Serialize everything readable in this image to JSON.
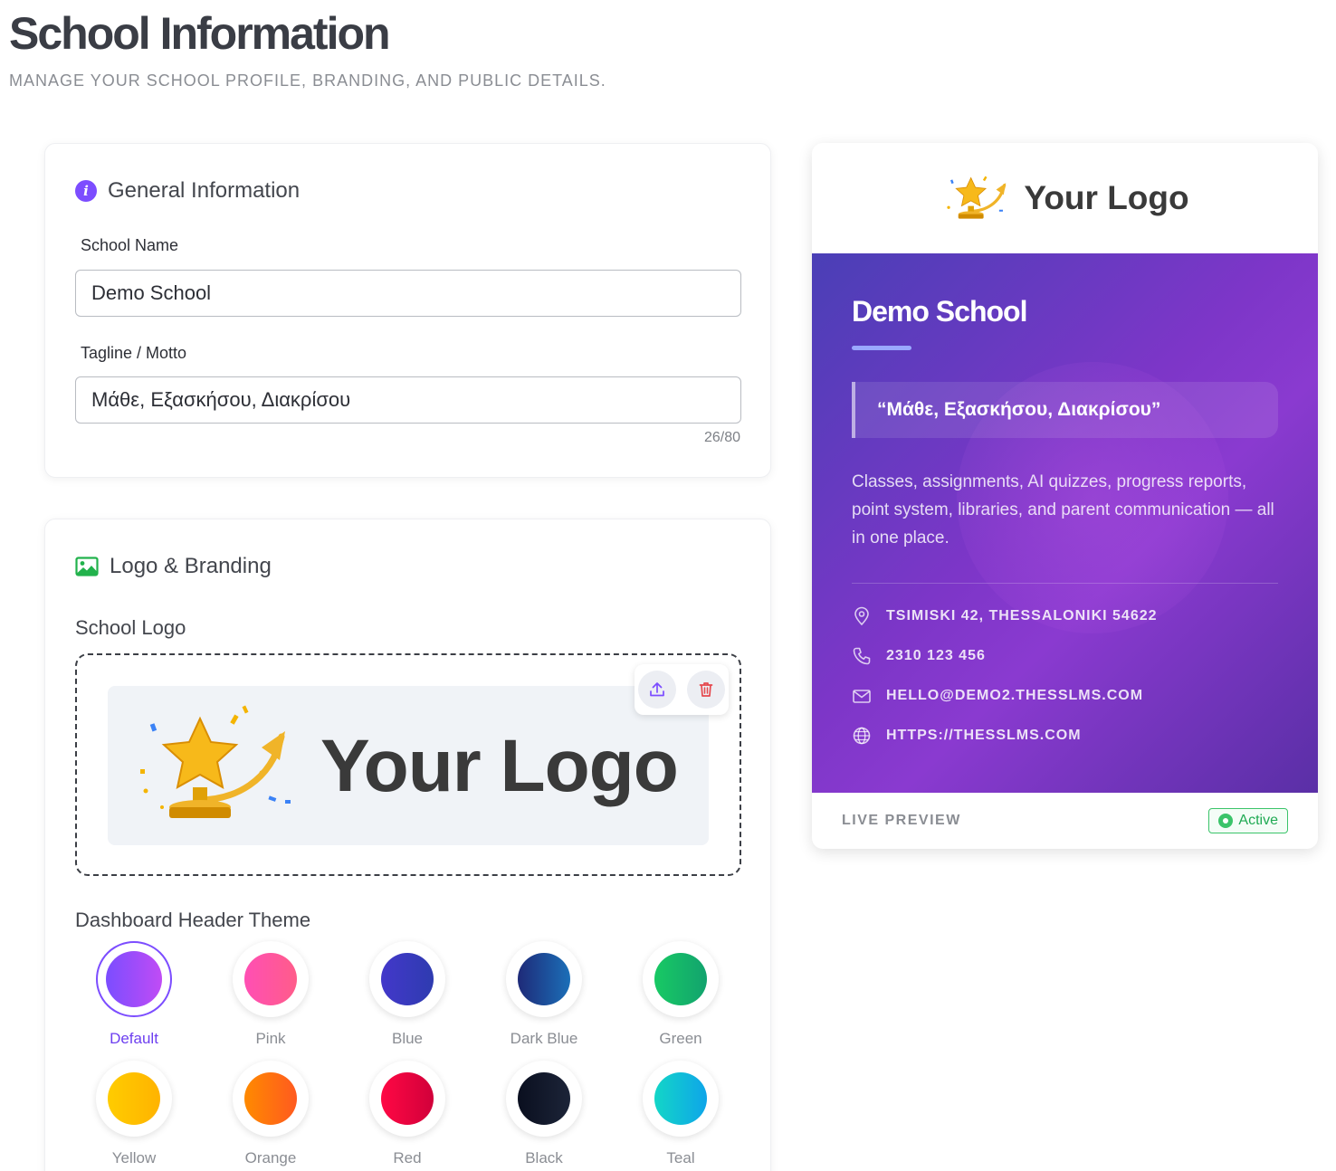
{
  "page": {
    "title": "School Information",
    "subtitle": "MANAGE YOUR SCHOOL PROFILE, BRANDING, AND PUBLIC DETAILS."
  },
  "general": {
    "heading": "General Information",
    "school_name_label": "School Name",
    "school_name_value": "Demo School",
    "tagline_label": "Tagline / Motto",
    "tagline_value": "Μάθε, Εξασκήσου, Διακρίσου",
    "tagline_counter": "26/80"
  },
  "branding": {
    "heading": "Logo & Branding",
    "logo_label": "School Logo",
    "logo_text": "Your Logo",
    "theme_label": "Dashboard Header Theme",
    "selected_theme": "Default",
    "themes": [
      {
        "name": "Default",
        "from": "#7b4dff",
        "to": "#c04cf5"
      },
      {
        "name": "Pink",
        "from": "#ff4fb4",
        "to": "#ff5c8a"
      },
      {
        "name": "Blue",
        "from": "#4338ca",
        "to": "#2e3bb0"
      },
      {
        "name": "Dark Blue",
        "from": "#1e2a78",
        "to": "#1b6fb8"
      },
      {
        "name": "Green",
        "from": "#18c964",
        "to": "#12a36e"
      },
      {
        "name": "Yellow",
        "from": "#ffcc00",
        "to": "#ffb300"
      },
      {
        "name": "Orange",
        "from": "#ff8a00",
        "to": "#ff5a1f"
      },
      {
        "name": "Red",
        "from": "#ff0844",
        "to": "#d1003a"
      },
      {
        "name": "Black",
        "from": "#0a0f1f",
        "to": "#1c2438"
      },
      {
        "name": "Teal",
        "from": "#13d6c7",
        "to": "#0ea5e9"
      }
    ]
  },
  "preview": {
    "logo_text": "Your Logo",
    "school_name": "Demo School",
    "quote": "“Μάθε, Εξασκήσου, Διακρίσου”",
    "description": "Classes, assignments, AI quizzes, progress reports, point system, libraries, and parent communication — all in one place.",
    "address": "TSIMISKI 42, THESSALONIKI 54622",
    "phone": "2310 123 456",
    "email": "HELLO@DEMO2.THESSLMS.COM",
    "website": "HTTPS://THESSLMS.COM",
    "footer_label": "LIVE PREVIEW",
    "status": "Active"
  },
  "colors": {
    "accent": "#7c4dff",
    "status_green": "#3bc46a",
    "hero_start": "#4a3fb6",
    "hero_end": "#8a3ad0"
  }
}
